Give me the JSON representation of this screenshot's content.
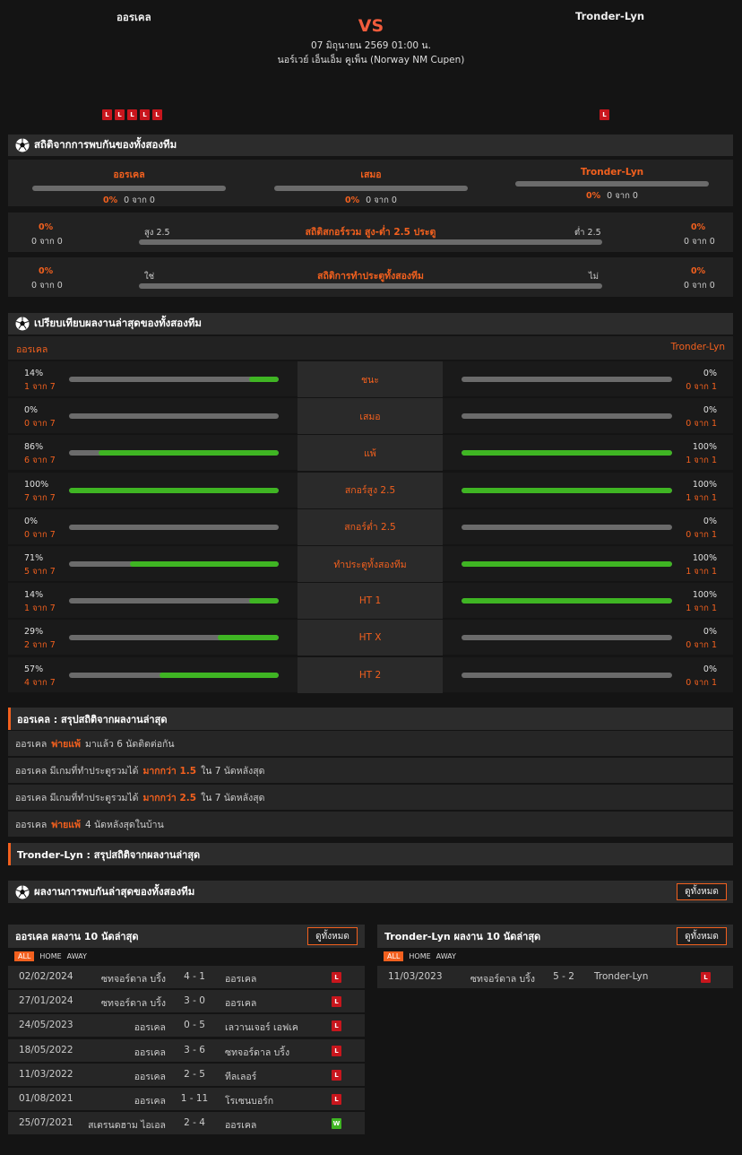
{
  "header": {
    "home_team": "ออรเคล",
    "away_team": "Tronder-Lyn",
    "vs": "VS",
    "datetime": "07 มิถุนายน 2569 01:00 น.",
    "league": "นอร์เวย์ เอ็นเอ็ม คูเพ็น (Norway NM Cupen)",
    "home_form": [
      "L",
      "L",
      "L",
      "L",
      "L"
    ],
    "away_form": [
      "L"
    ]
  },
  "h2h": {
    "title": "สถิติจากการพบกันของทั้งสองทีม",
    "cols": [
      {
        "label": "ออรเคล",
        "pct": "0%",
        "count": "0 จาก 0"
      },
      {
        "label": "เสมอ",
        "pct": "0%",
        "count": "0 จาก 0"
      },
      {
        "label": "Tronder-Lyn",
        "pct": "0%",
        "count": "0 จาก 0"
      }
    ],
    "ou": {
      "title": "สถิติสกอร์รวม สูง-ต่ำ 2.5 ประตู",
      "left_label": "สูง 2.5",
      "right_label": "ต่ำ 2.5",
      "left_pct": "0%",
      "left_count": "0 จาก 0",
      "right_pct": "0%",
      "right_count": "0 จาก 0"
    },
    "btts": {
      "title": "สถิติการทำประตูทั้งสองทีม",
      "left_label": "ใช่",
      "right_label": "ไม่",
      "left_pct": "0%",
      "left_count": "0 จาก 0",
      "right_pct": "0%",
      "right_count": "0 จาก 0"
    }
  },
  "compare": {
    "title": "เปรียบเทียบผลงานล่าสุดของทั้งสองทีม",
    "home": "ออรเคล",
    "away": "Tronder-Lyn",
    "rows": [
      {
        "label": "ชนะ",
        "lpct": "14%",
        "lcount": "1 จาก 7",
        "lval": 0.14,
        "rpct": "0%",
        "rcount": "0 จาก 1",
        "rval": 0
      },
      {
        "label": "เสมอ",
        "lpct": "0%",
        "lcount": "0 จาก 7",
        "lval": 0,
        "rpct": "0%",
        "rcount": "0 จาก 1",
        "rval": 0
      },
      {
        "label": "แพ้",
        "lpct": "86%",
        "lcount": "6 จาก 7",
        "lval": 0.86,
        "rpct": "100%",
        "rcount": "1 จาก 1",
        "rval": 1
      },
      {
        "label": "สกอร์สูง 2.5",
        "lpct": "100%",
        "lcount": "7 จาก 7",
        "lval": 1,
        "rpct": "100%",
        "rcount": "1 จาก 1",
        "rval": 1
      },
      {
        "label": "สกอร์ต่ำ 2.5",
        "lpct": "0%",
        "lcount": "0 จาก 7",
        "lval": 0,
        "rpct": "0%",
        "rcount": "0 จาก 1",
        "rval": 0
      },
      {
        "label": "ทำประตูทั้งสองทีม",
        "lpct": "71%",
        "lcount": "5 จาก 7",
        "lval": 0.71,
        "rpct": "100%",
        "rcount": "1 จาก 1",
        "rval": 1
      },
      {
        "label": "HT 1",
        "lpct": "14%",
        "lcount": "1 จาก 7",
        "lval": 0.14,
        "rpct": "100%",
        "rcount": "1 จาก 1",
        "rval": 1
      },
      {
        "label": "HT X",
        "lpct": "29%",
        "lcount": "2 จาก 7",
        "lval": 0.29,
        "rpct": "0%",
        "rcount": "0 จาก 1",
        "rval": 0
      },
      {
        "label": "HT 2",
        "lpct": "57%",
        "lcount": "4 จาก 7",
        "lval": 0.57,
        "rpct": "0%",
        "rcount": "0 จาก 1",
        "rval": 0
      }
    ]
  },
  "summary": {
    "home_title": "ออรเคล : สรุปสถิติจากผลงานล่าสุด",
    "home_lines": [
      [
        "ออรเคล",
        "พ่ายแพ้",
        "มาแล้ว 6 นัดติดต่อกัน"
      ],
      [
        "ออรเคล  มีเกมที่ทำประตูรวมได้",
        "มากกว่า  1.5",
        "ใน 7 นัดหลังสุด"
      ],
      [
        "ออรเคล  มีเกมที่ทำประตูรวมได้",
        "มากกว่า  2.5",
        "ใน 7 นัดหลังสุด"
      ],
      [
        "ออรเคล",
        "พ่ายแพ้",
        "4  นัดหลังสุดในบ้าน"
      ]
    ],
    "away_title": "Tronder-Lyn : สรุปสถิติจากผลงานล่าสุด"
  },
  "recent": {
    "title": "ผลงานการพบกันล่าสุดของทั้งสองทีม",
    "view_all": "ดูทั้งหมด",
    "filters": [
      "ALL",
      "HOME",
      "AWAY"
    ],
    "home_title": "ออรเคล ผลงาน 10 นัดล่าสุด",
    "away_title": "Tronder-Lyn ผลงาน 10 นัดล่าสุด",
    "home_matches": [
      {
        "date": "02/02/2024",
        "home": "ซทจอร์ดาล บริ้ง",
        "score": "4 - 1",
        "away": "ออรเคล",
        "res": "L"
      },
      {
        "date": "27/01/2024",
        "home": "ซทจอร์ดาล บริ้ง",
        "score": "3 - 0",
        "away": "ออรเคล",
        "res": "L"
      },
      {
        "date": "24/05/2023",
        "home": "ออรเคล",
        "score": "0 - 5",
        "away": "เลวานเจอร์ เอฟเค",
        "res": "L"
      },
      {
        "date": "18/05/2022",
        "home": "ออรเคล",
        "score": "3 - 6",
        "away": "ซทจอร์ดาล บริ้ง",
        "res": "L"
      },
      {
        "date": "11/03/2022",
        "home": "ออรเคล",
        "score": "2 - 5",
        "away": "ทีลเลอร์",
        "res": "L"
      },
      {
        "date": "01/08/2021",
        "home": "ออรเคล",
        "score": "1 - 11",
        "away": "โรเซนบอร์ก",
        "res": "L"
      },
      {
        "date": "25/07/2021",
        "home": "สเตรนดฮาม ไอเอล",
        "score": "2 - 4",
        "away": "ออรเคล",
        "res": "W"
      }
    ],
    "away_matches": [
      {
        "date": "11/03/2023",
        "home": "ซทจอร์ดาล บริ้ง",
        "score": "5 - 2",
        "away": "Tronder-Lyn",
        "res": "L"
      }
    ]
  }
}
